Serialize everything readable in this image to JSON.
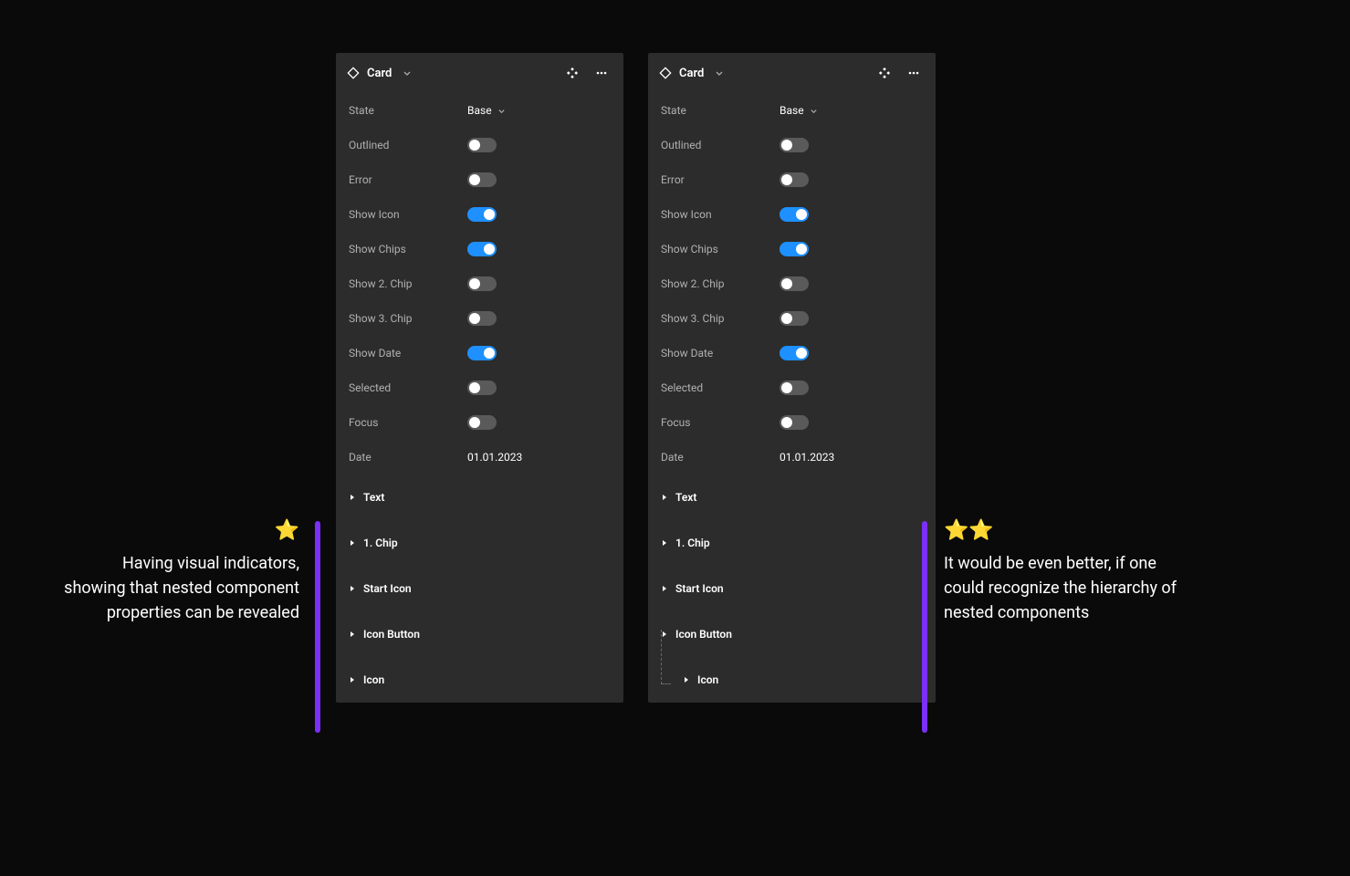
{
  "component": {
    "name": "Card",
    "state_label": "State",
    "state_value": "Base",
    "date_label": "Date",
    "date_value": "01.01.2023",
    "toggles": [
      {
        "label": "Outlined",
        "on": false
      },
      {
        "label": "Error",
        "on": false
      },
      {
        "label": "Show Icon",
        "on": true
      },
      {
        "label": "Show Chips",
        "on": true
      },
      {
        "label": "Show 2. Chip",
        "on": false
      },
      {
        "label": "Show 3. Chip",
        "on": false
      },
      {
        "label": "Show Date",
        "on": true
      },
      {
        "label": "Selected",
        "on": false
      },
      {
        "label": "Focus",
        "on": false
      }
    ],
    "nested": [
      {
        "label": "Text",
        "indent": 0
      },
      {
        "label": "1. Chip",
        "indent": 0
      },
      {
        "label": "Start Icon",
        "indent": 0
      },
      {
        "label": "Icon Button",
        "indent": 0
      },
      {
        "label": "Icon",
        "indent": 0
      }
    ],
    "nested_right": [
      {
        "label": "Text",
        "indent": 0
      },
      {
        "label": "1. Chip",
        "indent": 0
      },
      {
        "label": "Start Icon",
        "indent": 0
      },
      {
        "label": "Icon Button",
        "indent": 0
      },
      {
        "label": "Icon",
        "indent": 1
      }
    ]
  },
  "captions": {
    "left_stars": "⭐",
    "left_text": "Having visual indicators, showing that nested component properties can be revealed",
    "right_stars": "⭐⭐",
    "right_text": "It would be even better, if one could recognize the hierarchy of nested components"
  },
  "colors": {
    "accent": "#7b2ff7",
    "toggle_on": "#1e90ff",
    "panel_bg": "#2c2c2c"
  }
}
